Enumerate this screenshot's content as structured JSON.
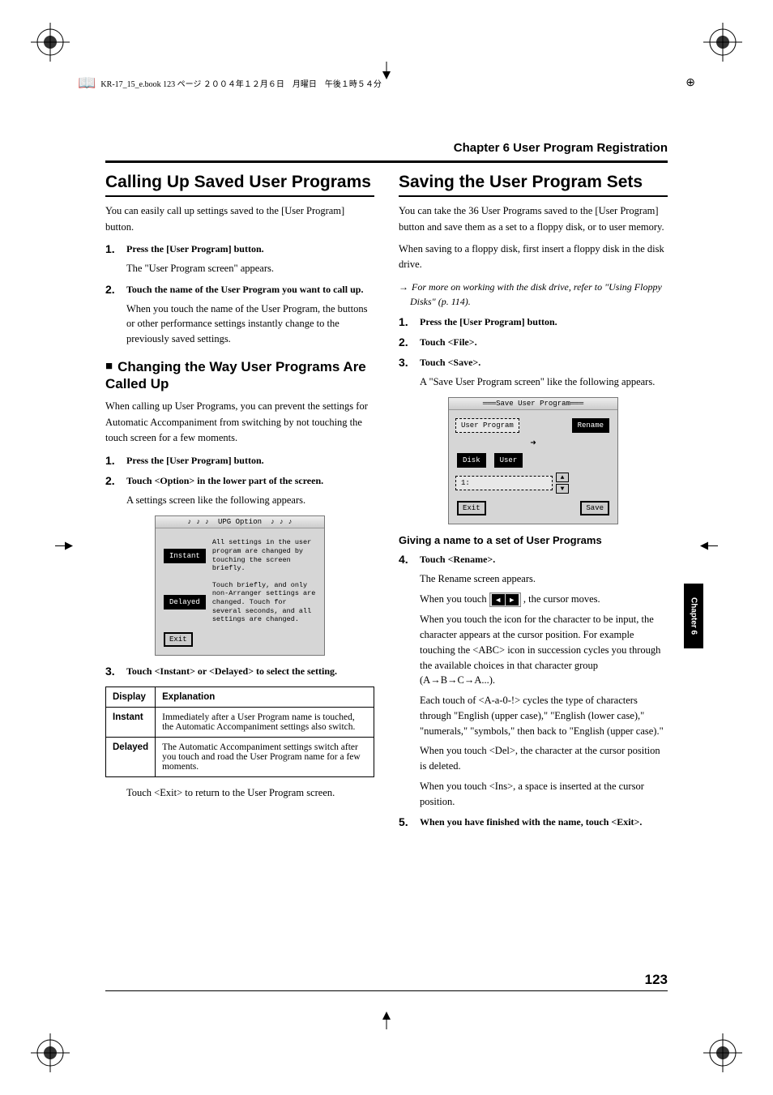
{
  "header_note": "KR-17_15_e.book 123 ページ ２００４年１２月６日　月曜日　午後１時５４分",
  "chapter_header": "Chapter 6 User Program Registration",
  "side_tab": "Chapter 6",
  "page_number": "123",
  "left": {
    "title": "Calling Up Saved User Programs",
    "intro": "You can easily call up settings saved to the [User Program] button.",
    "steps1": [
      {
        "bold": "Press the [User Program] button.",
        "body": "The \"User Program screen\" appears."
      },
      {
        "bold": "Touch the name of the User Program you want to call up.",
        "body": "When you touch the name of the User Program, the buttons or other performance settings instantly change to the previously saved settings."
      }
    ],
    "sub_title": "Changing the Way User Programs Are Called Up",
    "sub_intro": "When calling up User Programs, you can prevent the settings for Automatic Accompaniment from switching by not touching the touch screen for a few moments.",
    "steps2": [
      {
        "bold": "Press the [User Program] button.",
        "body": ""
      },
      {
        "bold": "Touch <Option> in the lower part of the screen.",
        "body": "A settings screen like the following appears."
      }
    ],
    "upg_screenshot": {
      "title": "UPG Option",
      "instant_btn": "Instant",
      "instant_desc": "All settings in the user program are changed by touching the screen briefly.",
      "delayed_btn": "Delayed",
      "delayed_desc": "Touch briefly, and only non-Arranger settings are changed. Touch for several seconds, and all settings are changed.",
      "exit_btn": "Exit"
    },
    "step3": {
      "bold": "Touch <Instant> or <Delayed> to select the setting."
    },
    "table": {
      "headers": [
        "Display",
        "Explanation"
      ],
      "rows": [
        [
          "Instant",
          "Immediately after a User Program name is touched, the Automatic Accompaniment settings also switch."
        ],
        [
          "Delayed",
          "The Automatic Accompaniment settings switch after you touch and road the User Program name for a few moments."
        ]
      ]
    },
    "exit_note": "Touch <Exit> to return to the User Program screen."
  },
  "right": {
    "title": "Saving the User Program Sets",
    "intro1": "You can take the 36 User Programs saved to the [User Program] button and save them as a set to a floppy disk, or to user memory.",
    "intro2": "When saving to a floppy disk, first insert a floppy disk in the disk drive.",
    "note": "For more on working with the disk drive, refer to \"Using Floppy Disks\" (p. 114).",
    "steps": [
      {
        "bold": "Press the [User Program] button."
      },
      {
        "bold": "Touch <File>."
      },
      {
        "bold": "Touch <Save>.",
        "body": "A \"Save User Program screen\" like the following appears."
      }
    ],
    "save_screenshot": {
      "title": "Save User Program",
      "field": "User Program",
      "rename_btn": "Rename",
      "disk_btn": "Disk",
      "user_btn": "User",
      "slot": "1:",
      "exit_btn": "Exit",
      "save_btn": "Save"
    },
    "subsub": "Giving a name to a set of User Programs",
    "step4": {
      "bold": "Touch <Rename>.",
      "body": "The Rename screen appears."
    },
    "cursor_line_a": "When you touch ",
    "cursor_line_b": ", the cursor moves.",
    "para1": "When you touch the icon for the character to be input, the character appears at the cursor position. For example touching the <ABC> icon in succession cycles you through the available choices in that character group (A→B→C→A...).",
    "para2": "Each touch of <A-a-0-!> cycles the type of characters through \"English (upper case),\" \"English (lower case),\" \"numerals,\" \"symbols,\" then back to \"English (upper case).\"",
    "para3": "When you touch <Del>, the character at the cursor position is deleted.",
    "para4": "When you touch <Ins>, a space is inserted at the cursor position.",
    "step5": {
      "bold": "When you have finished with the name, touch <Exit>."
    }
  }
}
